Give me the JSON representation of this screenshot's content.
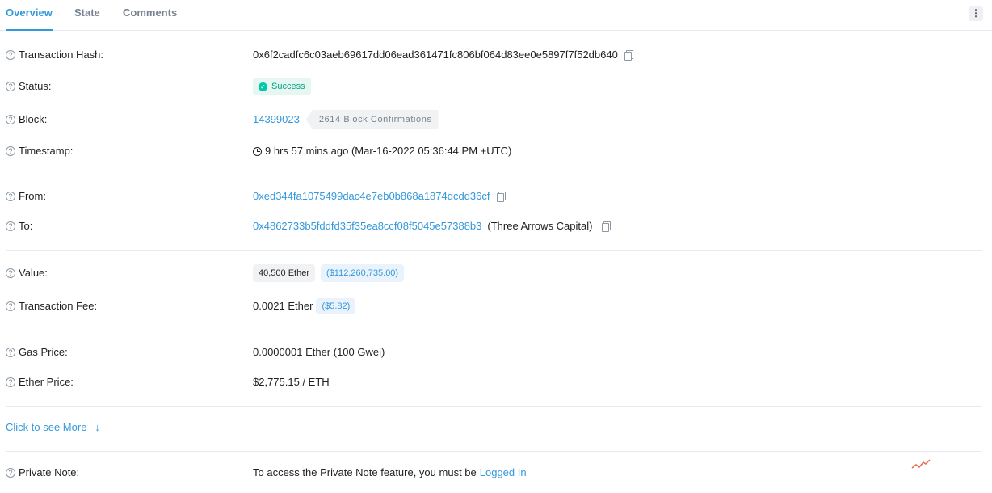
{
  "tabs": [
    {
      "label": "Overview",
      "active": true
    },
    {
      "label": "State",
      "active": false
    },
    {
      "label": "Comments",
      "active": false
    }
  ],
  "menu": {
    "icon": "kebab-menu-icon",
    "glyph": "⋮"
  },
  "overview": {
    "transaction_hash": {
      "label": "Transaction Hash:",
      "value": "0x6f2cadfc6c03aeb69617dd06ead361471fc806bf064d83ee0e5897f7f52db640"
    },
    "status": {
      "label": "Status:",
      "value": "Success"
    },
    "block": {
      "label": "Block:",
      "value": "14399023",
      "confirmations": "2614 Block Confirmations"
    },
    "timestamp": {
      "label": "Timestamp:",
      "value": "9 hrs 57 mins ago (Mar-16-2022 05:36:44 PM +UTC)"
    },
    "from": {
      "label": "From:",
      "value": "0xed344fa1075499dac4e7eb0b868a1874dcdd36cf"
    },
    "to": {
      "label": "To:",
      "value": "0x4862733b5fddfd35f35ea8ccf08f5045e57388b3",
      "name_tag": "(Three Arrows Capital)"
    },
    "value": {
      "label": "Value:",
      "ether": "40,500 Ether",
      "usd": "($112,260,735.00)"
    },
    "transaction_fee": {
      "label": "Transaction Fee:",
      "ether": "0.0021 Ether",
      "usd": "($5.82)"
    },
    "gas_price": {
      "label": "Gas Price:",
      "value": "0.0000001 Ether (100 Gwei)"
    },
    "ether_price": {
      "label": "Ether Price:",
      "value": "$2,775.15 / ETH"
    }
  },
  "see_more": {
    "label": "Click to see More",
    "icon": "arrow-down-icon"
  },
  "private_note": {
    "label": "Private Note:",
    "text": "To access the Private Note feature, you must be",
    "link": "Logged In"
  },
  "colors": {
    "accent": "#3498db",
    "success": "#00c9a7",
    "text": "#1e2022",
    "muted": "#77838f"
  }
}
